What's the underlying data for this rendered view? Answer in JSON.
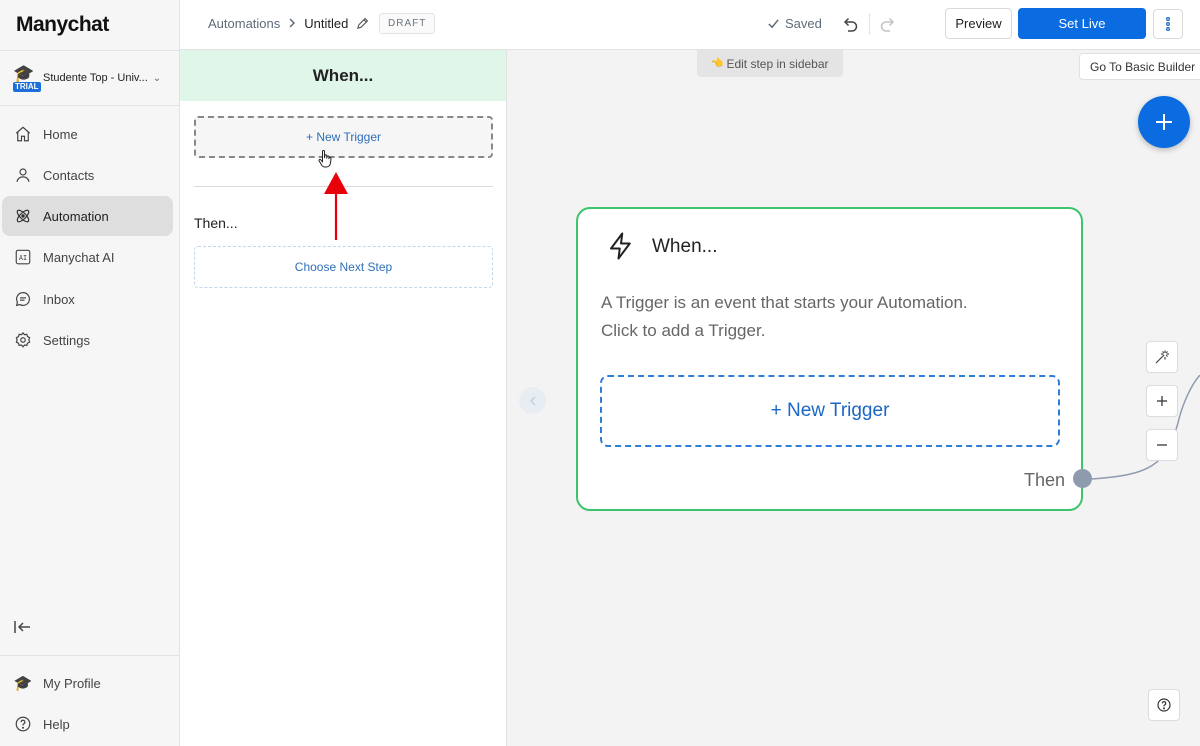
{
  "brand": {
    "logo_text": "Manychat"
  },
  "account": {
    "name": "Studente Top - Univ...",
    "badge": "TRIAL"
  },
  "nav": {
    "items": [
      {
        "label": "Home",
        "icon": "home-icon"
      },
      {
        "label": "Contacts",
        "icon": "user-icon"
      },
      {
        "label": "Automation",
        "icon": "automation-icon",
        "active": true
      },
      {
        "label": "Manychat AI",
        "icon": "ai-icon"
      },
      {
        "label": "Inbox",
        "icon": "chat-icon"
      },
      {
        "label": "Settings",
        "icon": "gear-icon"
      }
    ],
    "bottom": [
      {
        "label": "My Profile",
        "icon": "profile-avatar-icon"
      },
      {
        "label": "Help",
        "icon": "help-icon"
      }
    ]
  },
  "header": {
    "breadcrumb_root": "Automations",
    "breadcrumb_current": "Untitled",
    "status_badge": "DRAFT",
    "saved_label": "Saved",
    "preview_label": "Preview",
    "set_live_label": "Set Live"
  },
  "panel": {
    "title": "When...",
    "new_trigger_label": "+ New Trigger",
    "then_label": "Then...",
    "choose_next_label": "Choose Next Step"
  },
  "canvas": {
    "hint": "Edit step in sidebar",
    "basic_builder_label": "Go To Basic Builder",
    "node": {
      "title": "When...",
      "description_line1": "A Trigger is an event that starts your Automation.",
      "description_line2": "Click to add a Trigger.",
      "new_trigger_label": "+ New Trigger",
      "then_label": "Then"
    }
  },
  "colors": {
    "primary": "#0a6ce0",
    "node_border": "#3bc46a",
    "panel_header_bg": "#e0f6e8",
    "annotation_arrow": "#e8000a"
  }
}
